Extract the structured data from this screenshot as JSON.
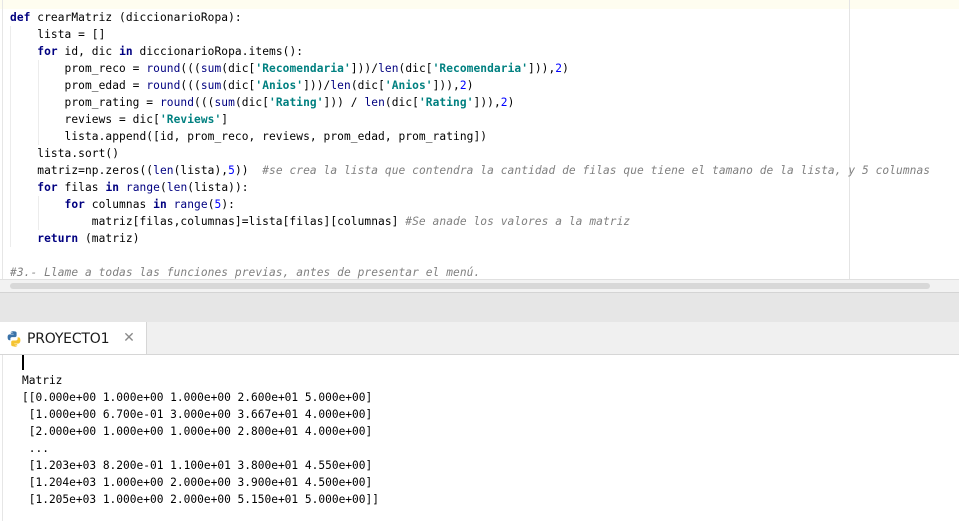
{
  "editor": {
    "lines": [
      [
        [
          "kw",
          "def"
        ],
        [
          "t",
          " crearMatriz (diccionarioRopa):"
        ]
      ],
      [
        [
          "t",
          "    lista = []"
        ]
      ],
      [
        [
          "t",
          "    "
        ],
        [
          "kw",
          "for"
        ],
        [
          "t",
          " id, dic "
        ],
        [
          "kw",
          "in"
        ],
        [
          "t",
          " diccionarioRopa.items():"
        ]
      ],
      [
        [
          "t",
          "        prom_reco = "
        ],
        [
          "bi",
          "round"
        ],
        [
          "t",
          "((("
        ],
        [
          "bi",
          "sum"
        ],
        [
          "t",
          "(dic["
        ],
        [
          "str",
          "'Recomendaria'"
        ],
        [
          "t",
          "]))/"
        ],
        [
          "bi",
          "len"
        ],
        [
          "t",
          "(dic["
        ],
        [
          "str",
          "'Recomendaria'"
        ],
        [
          "t",
          "])),"
        ],
        [
          "num",
          "2"
        ],
        [
          "t",
          ")"
        ]
      ],
      [
        [
          "t",
          "        prom_edad = "
        ],
        [
          "bi",
          "round"
        ],
        [
          "t",
          "((("
        ],
        [
          "bi",
          "sum"
        ],
        [
          "t",
          "(dic["
        ],
        [
          "str",
          "'Anios'"
        ],
        [
          "t",
          "]))/"
        ],
        [
          "bi",
          "len"
        ],
        [
          "t",
          "(dic["
        ],
        [
          "str",
          "'Anios'"
        ],
        [
          "t",
          "])),"
        ],
        [
          "num",
          "2"
        ],
        [
          "t",
          ")"
        ]
      ],
      [
        [
          "t",
          "        prom_rating = "
        ],
        [
          "bi",
          "round"
        ],
        [
          "t",
          "((("
        ],
        [
          "bi",
          "sum"
        ],
        [
          "t",
          "(dic["
        ],
        [
          "str",
          "'Rating'"
        ],
        [
          "t",
          "])) / "
        ],
        [
          "bi",
          "len"
        ],
        [
          "t",
          "(dic["
        ],
        [
          "str",
          "'Rating'"
        ],
        [
          "t",
          "])),"
        ],
        [
          "num",
          "2"
        ],
        [
          "t",
          ")"
        ]
      ],
      [
        [
          "t",
          "        reviews = dic["
        ],
        [
          "str",
          "'Reviews'"
        ],
        [
          "t",
          "]"
        ]
      ],
      [
        [
          "t",
          "        lista.append([id, prom_reco, reviews, prom_edad, prom_rating])"
        ]
      ],
      [
        [
          "t",
          "    lista.sort()"
        ]
      ],
      [
        [
          "t",
          "    matriz=np.zeros(("
        ],
        [
          "bi",
          "len"
        ],
        [
          "t",
          "(lista),"
        ],
        [
          "num",
          "5"
        ],
        [
          "t",
          "))  "
        ],
        [
          "cmt",
          "#se crea la lista que contendra la cantidad de filas que tiene el tamano de la lista, y 5 columnas"
        ]
      ],
      [
        [
          "t",
          "    "
        ],
        [
          "kw",
          "for"
        ],
        [
          "t",
          " filas "
        ],
        [
          "kw",
          "in"
        ],
        [
          "t",
          " "
        ],
        [
          "bi",
          "range"
        ],
        [
          "t",
          "("
        ],
        [
          "bi",
          "len"
        ],
        [
          "t",
          "(lista)):"
        ]
      ],
      [
        [
          "t",
          "        "
        ],
        [
          "kw",
          "for"
        ],
        [
          "t",
          " columnas "
        ],
        [
          "kw",
          "in"
        ],
        [
          "t",
          " "
        ],
        [
          "bi",
          "range"
        ],
        [
          "t",
          "("
        ],
        [
          "num",
          "5"
        ],
        [
          "t",
          "):"
        ]
      ],
      [
        [
          "t",
          "            matriz[filas,columnas]=lista[filas][columnas] "
        ],
        [
          "cmt",
          "#Se anade los valores a la matriz"
        ]
      ],
      [
        [
          "t",
          "    "
        ],
        [
          "kw",
          "return"
        ],
        [
          "t",
          " (matriz)"
        ]
      ],
      [
        [
          "t",
          ""
        ]
      ],
      [
        [
          "cmt",
          "#3.- Llame a todas las funciones previas, antes de presentar el menú."
        ]
      ]
    ]
  },
  "console": {
    "tab_label": "PROYECTO1",
    "close_icon": "close-icon",
    "python_icon": "python-icon",
    "output": [
      "Matriz",
      "[[0.000e+00 1.000e+00 1.000e+00 2.600e+01 5.000e+00]",
      " [1.000e+00 6.700e-01 3.000e+00 3.667e+01 4.000e+00]",
      " [2.000e+00 1.000e+00 1.000e+00 2.800e+01 4.000e+00]",
      " ...",
      " [1.203e+03 8.200e-01 1.100e+01 3.800e+01 4.550e+00]",
      " [1.204e+03 1.000e+00 2.000e+00 3.900e+01 4.500e+00]",
      " [1.205e+03 1.000e+00 2.000e+00 5.150e+01 5.000e+00]]"
    ]
  },
  "colors": {
    "keyword": "#000080",
    "string": "#008080",
    "number": "#0000ff",
    "comment": "#808080",
    "python_blue": "#3a72a8",
    "python_yellow": "#f5c432"
  }
}
